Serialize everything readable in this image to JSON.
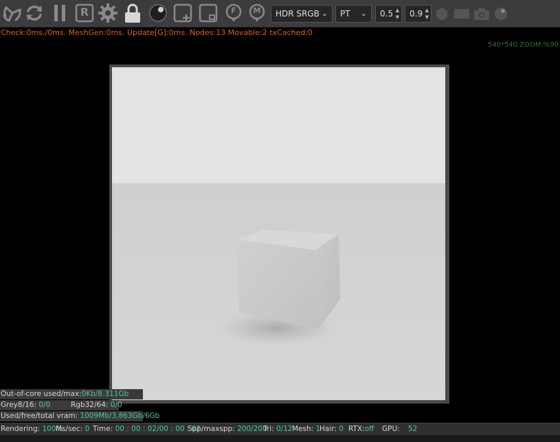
{
  "toolbar": {
    "icons": [
      "reset-camera-icon",
      "restart-icon",
      "pause-icon",
      "r-icon",
      "settings-gear-icon",
      "lock-icon",
      "sphere-icon",
      "add-region-icon",
      "subtract-region-icon",
      "focus-f-icon",
      "material-m-icon",
      "hexagon-icon",
      "rectangle-icon",
      "camera-icon",
      "sphere-small-icon"
    ],
    "r_label": "R",
    "f_label": "F",
    "m_label": "M",
    "color_space": "HDR SRGB",
    "kernel": "PT",
    "value1": "0.5",
    "value2": "0.9"
  },
  "stats_line": "Check:0ms./0ms. MeshGen:0ms. Update[G]:0ms. Nodes:13 Movable:2 txCached:0",
  "zoom_label": "540*540 ZOOM:%90",
  "info": {
    "out_of_core_label": "Out-of-core used/max:",
    "out_of_core_value": "0Kb/8.311Gb",
    "grey_label": "Grey8/16:",
    "grey_value": "0/0",
    "rgb_label": "Rgb32/64:",
    "rgb_value": "0/0",
    "vram_label": "Used/free/total vram:",
    "vram_value": "1009Mb/3.863Gb/6Gb"
  },
  "status": {
    "rendering_label": "Rendering:",
    "rendering_value": "100%",
    "ms_label": "Ms/sec:",
    "ms_value": "0",
    "time_label": "Time:",
    "time_value": "00 : 00 : 02/00 : 00 : 02",
    "spp_label": "Spp/maxspp:",
    "spp_value": "200/200",
    "tri_label": "Tri:",
    "tri_value": "0/12",
    "mesh_label": "Mesh:",
    "mesh_value": "1",
    "hair_label": "Hair:",
    "hair_value": "0",
    "rtx_label": "RTX:",
    "rtx_value": "off",
    "gpu_label": "GPU:",
    "gpu_value": "52"
  },
  "colors": {
    "toolbar_bg": "#3c3c3c",
    "stats_orange": "#e06010",
    "value_teal": "#49c8a0",
    "icon_gray": "#8a8a8a"
  }
}
